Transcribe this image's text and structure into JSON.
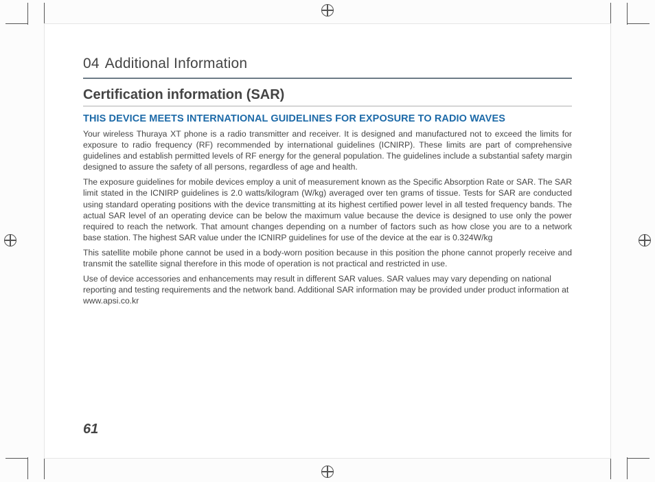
{
  "chapter": {
    "number": "04",
    "title": "Additional Information"
  },
  "heading": "Certification information (SAR)",
  "subheading": "THIS DEVICE MEETS INTERNATIONAL GUIDELINES FOR EXPOSURE TO RADIO WAVES",
  "paragraphs": [
    "Your wireless Thuraya XT phone is a radio transmitter and receiver. It is designed and manufactured not to exceed the limits for exposure to radio frequency (RF) recommended by international guidelines (ICNIRP). These limits are part of comprehensive guidelines and establish permitted levels of RF energy for the general population. The guidelines include a substantial safety margin designed to assure the safety of all persons, regardless of age and health.",
    "The exposure guidelines for mobile devices employ a unit of measurement known as the Specific Absorption Rate or SAR. The SAR limit stated in the ICNIRP guidelines is 2.0 watts/kilogram (W/kg) averaged over ten grams of tissue. Tests for SAR are conducted using standard operating positions with the device transmitting at its highest certified power level in all tested frequency bands. The actual SAR level of an operating device can be below the maximum value because the device is designed to use only the power required to reach the network. That amount changes depending on a number of factors such as how close you are to a network base station. The highest SAR value under the ICNIRP guidelines for use of the device at the ear is 0.324W/kg",
    "This satellite mobile phone cannot be used in a body-worn position because in this position the phone cannot properly receive and transmit the satellite signal therefore in this mode of operation is not practical and restricted in use.",
    "Use of device accessories and enhancements may result in different SAR values. SAR values may vary depending on national reporting and testing requirements and the network band. Additional SAR information may be provided under product information at www.apsi.co.kr"
  ],
  "page_number": "61"
}
